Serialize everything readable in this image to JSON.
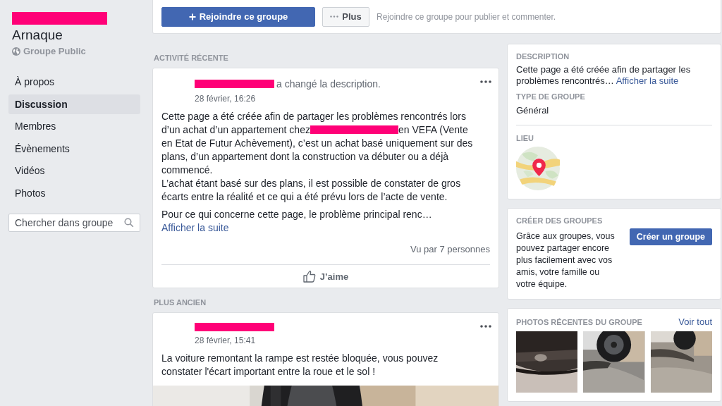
{
  "group": {
    "name": "Arnaque",
    "privacy": "Groupe Public"
  },
  "nav": [
    {
      "label": "À propos",
      "selected": false
    },
    {
      "label": "Discussion",
      "selected": true
    },
    {
      "label": "Membres",
      "selected": false
    },
    {
      "label": "Évènements",
      "selected": false
    },
    {
      "label": "Vidéos",
      "selected": false
    },
    {
      "label": "Photos",
      "selected": false
    }
  ],
  "search": {
    "placeholder": "Chercher dans groupe"
  },
  "actions": {
    "join": "Rejoindre ce groupe",
    "more": "Plus",
    "hint": "Rejoindre ce groupe pour publier et commenter."
  },
  "sections": [
    {
      "heading": "ACTIVITÉ RÉCENTE",
      "post": {
        "action": "a changé la description.",
        "time": "28 février, 16:26",
        "paragraphs": [
          [
            {
              "kind": "text",
              "text": "Cette page a été créée afin de partager les problèmes rencontrés lors d’un achat d’un appartement chez"
            },
            {
              "kind": "redacted"
            },
            {
              "kind": "text",
              "text": "en VEFA (Vente en Etat de Futur Achèvement), c’est un achat basé uniquement sur des plans, d’un appartement dont la construction va débuter ou a déjà commencé."
            }
          ],
          [
            {
              "kind": "text",
              "text": "L’achat étant basé sur des plans, il est possible de constater de gros écarts entre la réalité et ce qui a été prévu lors de l’acte de vente."
            }
          ]
        ],
        "excerpt": "Pour ce qui concerne cette page, le problème principal renc…",
        "more_link": "Afficher la suite",
        "views": "Vu par 7 personnes",
        "like": "J’aime"
      }
    },
    {
      "heading": "PLUS ANCIEN",
      "post": {
        "time": "28 février, 15:41",
        "paragraphs": [
          [
            {
              "kind": "text",
              "text": "La voiture remontant la rampe est restée bloquée, vous pouvez constater l'écart important entre la roue et le sol !"
            }
          ]
        ],
        "photo": {
          "kind": "picture"
        }
      }
    }
  ],
  "about": {
    "description_label": "DESCRIPTION",
    "description": "Cette page a été créée afin de partager les problèmes rencontrés…",
    "description_link": "Afficher la suite",
    "type_label": "TYPE DE GROUPE",
    "type": "Général",
    "place_label": "LIEU",
    "map": {
      "kind": "picture"
    }
  },
  "create": {
    "heading": "CRÉER DES GROUPES",
    "text": "Grâce aux groupes, vous pouvez partager encore plus facilement avec vos amis, votre famille ou votre équipe.",
    "button": "Créer un groupe"
  },
  "photos": {
    "heading": "PHOTOS RÉCENTES DU GROUPE",
    "link": "Voir tout",
    "items": [
      {
        "kind": "picture"
      },
      {
        "kind": "picture"
      },
      {
        "kind": "picture"
      }
    ]
  }
}
